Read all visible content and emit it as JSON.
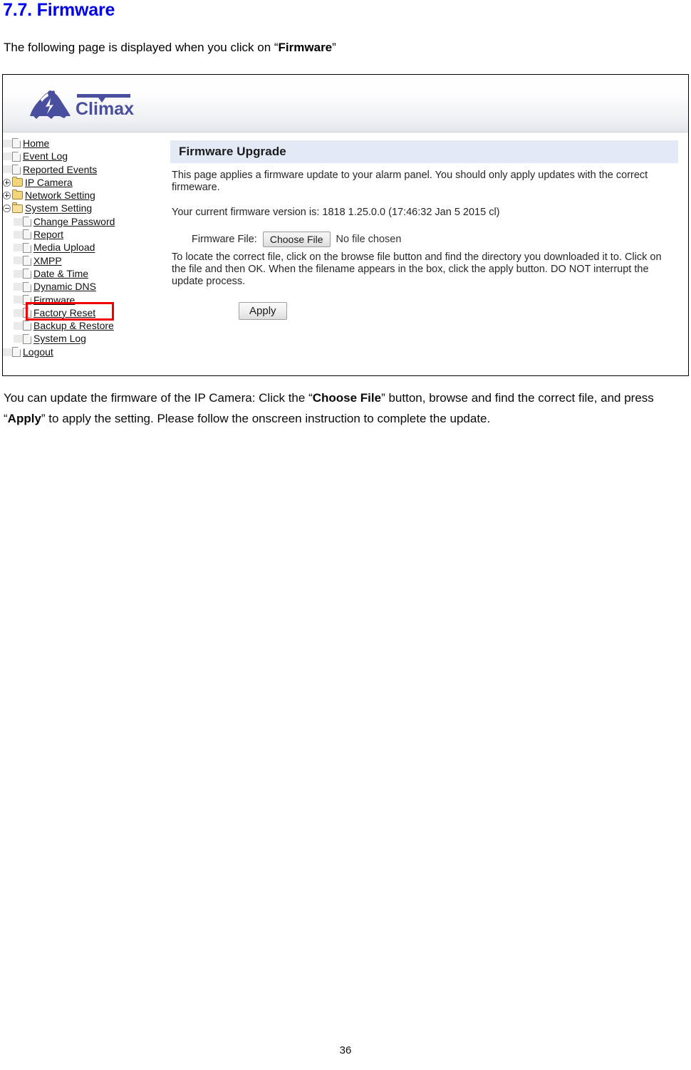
{
  "document": {
    "heading": "7.7. Firmware",
    "intro_prefix": "The following page is displayed when you click on “",
    "intro_bold": "Firmware",
    "intro_suffix": "”",
    "page_number": "36",
    "body_paragraph": {
      "part1": "You can update the firmware of the IP Camera: Click the “",
      "bold1": "Choose File",
      "part2": "” button, browse and find the correct file, and press “",
      "bold2": "Apply",
      "part3": "” to apply the setting. Please follow the onscreen instruction to complete the update."
    }
  },
  "screenshot": {
    "brand": {
      "name": "Climax",
      "logo_icon": "climax-mountain-lightning-logo",
      "color": "#4a4e9e"
    },
    "sidebar": {
      "items": [
        {
          "label": "Home",
          "icon": "page-icon",
          "level": 1,
          "expander": "none"
        },
        {
          "label": "Event Log",
          "icon": "page-icon",
          "level": 1,
          "expander": "none"
        },
        {
          "label": "Reported Events",
          "icon": "page-icon",
          "level": 1,
          "expander": "none"
        },
        {
          "label": "IP Camera",
          "icon": "folder-icon",
          "level": 1,
          "expander": "plus"
        },
        {
          "label": "Network Setting",
          "icon": "folder-icon",
          "level": 1,
          "expander": "plus"
        },
        {
          "label": "System Setting",
          "icon": "folder-open-icon",
          "level": 1,
          "expander": "minus"
        },
        {
          "label": "Change Password",
          "icon": "page-icon",
          "level": 2,
          "expander": "none"
        },
        {
          "label": "Report",
          "icon": "page-icon",
          "level": 2,
          "expander": "none"
        },
        {
          "label": "Media Upload",
          "icon": "page-icon",
          "level": 2,
          "expander": "none"
        },
        {
          "label": "XMPP",
          "icon": "page-icon",
          "level": 2,
          "expander": "none"
        },
        {
          "label": "Date & Time",
          "icon": "page-icon",
          "level": 2,
          "expander": "none"
        },
        {
          "label": "Dynamic DNS",
          "icon": "page-icon",
          "level": 2,
          "expander": "none"
        },
        {
          "label": "Firmware",
          "icon": "page-icon",
          "level": 2,
          "expander": "none",
          "highlighted": true
        },
        {
          "label": "Factory Reset",
          "icon": "page-icon",
          "level": 2,
          "expander": "none"
        },
        {
          "label": "Backup & Restore",
          "icon": "page-icon",
          "level": 2,
          "expander": "none"
        },
        {
          "label": "System Log",
          "icon": "page-icon",
          "level": 2,
          "expander": "none"
        },
        {
          "label": "Logout",
          "icon": "page-icon",
          "level": 1,
          "expander": "none"
        }
      ],
      "highlight_color": "#ee0000"
    },
    "content": {
      "panel_title": "Firmware Upgrade",
      "panel_title_bg": "#e3eaf6",
      "description": "This page applies a firmware update to your alarm panel. You should only apply updates with the correct firmeware.",
      "current_version_text": "Your current firmware version is: 1818 1.25.0.0 (17:46:32 Jan 5 2015 cl)",
      "file_label": "Firmware File:",
      "choose_file_button": "Choose File",
      "no_file_chosen": "No file chosen",
      "instructions": "To locate the correct file, click on the browse file button and find the directory you downloaded it to. Click on the file and then OK. When the filename appears in the box, click the apply button. DO NOT interrupt the update process.",
      "apply_button": "Apply"
    }
  }
}
